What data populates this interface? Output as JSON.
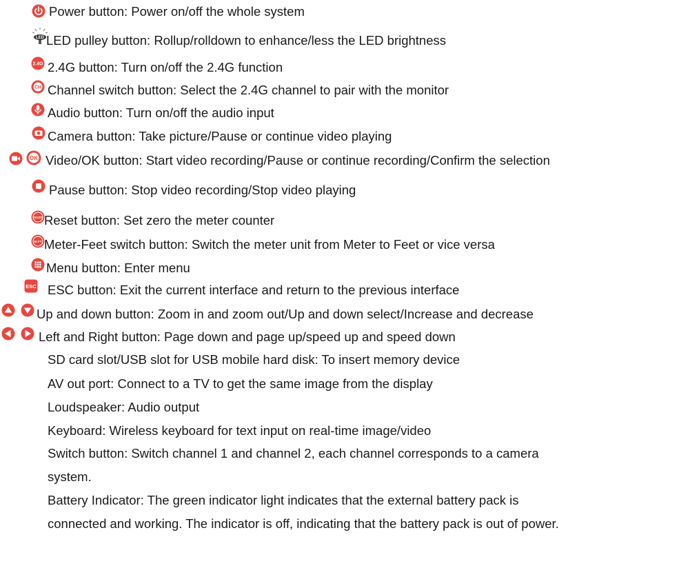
{
  "colors": {
    "accent_red": "#e8473f",
    "text": "#1a1a1a"
  },
  "items": [
    {
      "icon": "power-icon",
      "text": "Power  button: Power on/off the whole system"
    },
    {
      "icon": "led-pulley-icon",
      "icon_text": "LED",
      "text": "LED pulley button: Rollup/rolldown to enhance/less the LED brightness"
    },
    {
      "icon": "2.4g-icon",
      "icon_text": "2.4G",
      "text": "2.4G button: Turn on/off the 2.4G function"
    },
    {
      "icon": "channel-icon",
      "icon_text": "CH",
      "text": "Channel switch button: Select the 2.4G channel to pair with the monitor"
    },
    {
      "icon": "microphone-icon",
      "text": "Audio  button: Turn on/off the audio  input"
    },
    {
      "icon": "camera-icon",
      "text": "Camera button: Take picture/Pause or continue video  playing"
    },
    {
      "icon": "video-ok-icon",
      "icon_text": "OK",
      "text": "Video/OK button: Start video recording/Pause or continue recording/Confirm the selection"
    },
    {
      "icon": "pause-icon",
      "text": "Pause button: Stop video recording/Stop video playing"
    },
    {
      "icon": "reset-icon",
      "icon_text": "RESET",
      "text": "Reset button: Set zero the  meter counter"
    },
    {
      "icon": "meter-feet-icon",
      "icon_text": "M-FT",
      "text": "Meter-Feet switch button: Switch the meter unit from Meter to Feet or vice versa"
    },
    {
      "icon": "menu-icon",
      "text": "Menu button: Enter menu"
    },
    {
      "icon": "esc-icon",
      "icon_text": "ESC",
      "text": "ESC button: Exit the current interface and return to the previous interface"
    },
    {
      "icon": "up-down-icon",
      "text": "Up and down button: Zoom in and zoom out/Up and down select/Increase and decrease"
    },
    {
      "icon": "left-right-icon",
      "text": "Left and Right button: Page down and page up/speed up and speed down"
    },
    {
      "text": "SD card slot/USB slot for USB mobile hard disk: To insert memory device"
    },
    {
      "text": "AV out port: Connect to a TV to get the same image from the display"
    },
    {
      "text": "Loudspeaker: Audio output"
    },
    {
      "text": "Keyboard: Wireless keyboard for text input on real-time image/video"
    },
    {
      "text": "Switch button: Switch channel 1 and channel 2, each channel corresponds to a camera"
    },
    {
      "text": "system."
    },
    {
      "text": "Battery Indicator: The green indicator light indicates that the external battery pack is"
    },
    {
      "text": "connected and working. The indicator is off, indicating that the battery pack is out of power."
    }
  ]
}
